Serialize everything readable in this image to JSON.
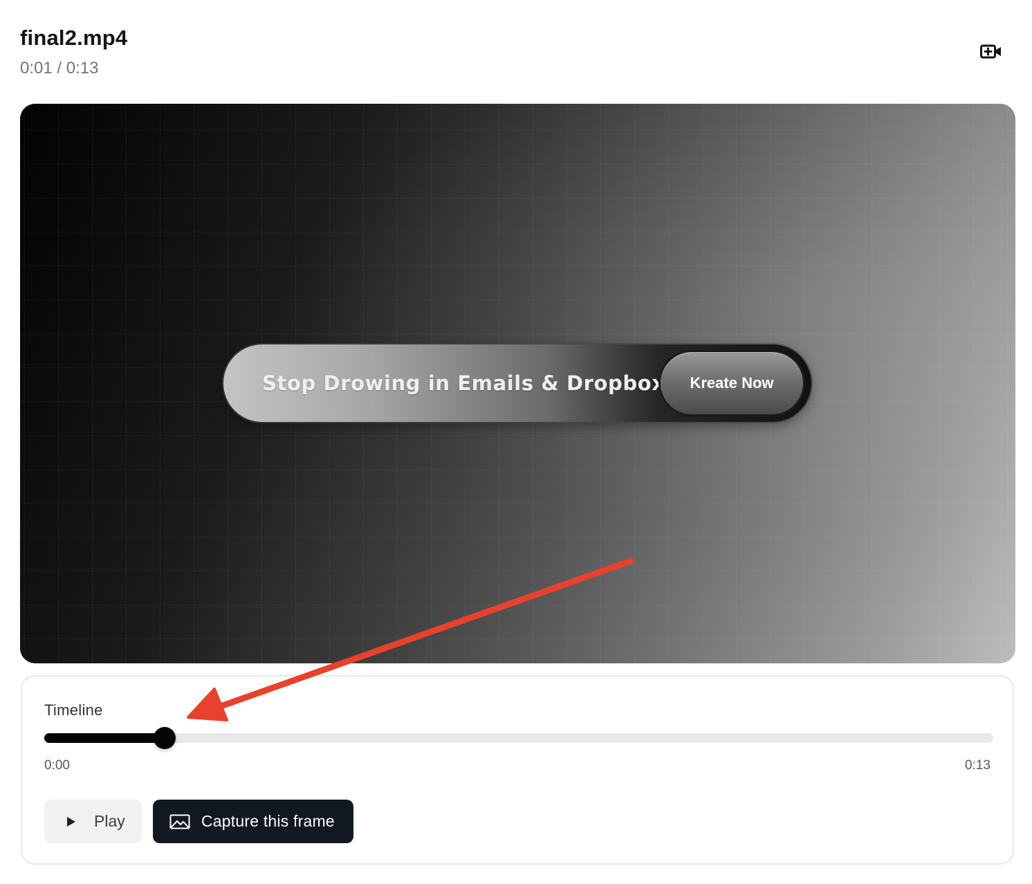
{
  "header": {
    "file_name": "final2.mp4",
    "time_readout": "0:01 / 0:13",
    "action_icon": "video-plus-icon"
  },
  "video": {
    "headline": "Stop Drowing in Emails & Dropbox",
    "cta_label": "Kreate Now"
  },
  "timeline": {
    "label": "Timeline",
    "start_time": "0:00",
    "end_time": "0:13",
    "progress_fraction": 0.127
  },
  "controls": {
    "play_label": "Play",
    "play_icon": "play-icon",
    "capture_label": "Capture this frame",
    "capture_icon": "image-icon"
  },
  "colors": {
    "annotation_arrow": "#e8412c",
    "primary_button": "#111820",
    "slider_fill": "#050505",
    "slider_track": "#e8e9eb"
  }
}
